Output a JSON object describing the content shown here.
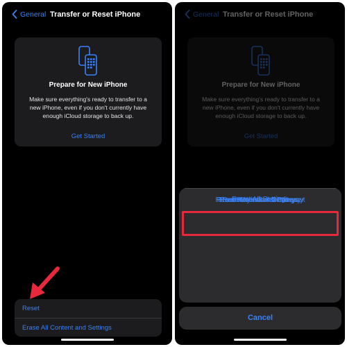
{
  "colors": {
    "accent": "#3a82f6",
    "highlight": "#e8283b",
    "arrow": "#e8283b"
  },
  "left": {
    "nav": {
      "back_label": "General",
      "title": "Transfer or Reset iPhone"
    },
    "card": {
      "icon": "transfer-phones-icon",
      "title": "Prepare for New iPhone",
      "description": "Make sure everything's ready to transfer to a new iPhone, even if you don't currently have enough iCloud storage to back up.",
      "link": "Get Started"
    },
    "list": {
      "items": [
        "Reset",
        "Erase All Content and Settings"
      ]
    }
  },
  "right": {
    "nav": {
      "back_label": "General",
      "title": "Transfer or Reset iPhone"
    },
    "card": {
      "icon": "transfer-phones-icon",
      "title": "Prepare for New iPhone",
      "description": "Make sure everything's ready to transfer to a new iPhone, even if you don't currently have enough iCloud storage to back up.",
      "link": "Get Started"
    },
    "action_sheet": {
      "options": [
        "Reset All Settings",
        "Reset Network Settings",
        "Reset Keyboard Dictionary",
        "Reset Home Screen Layout",
        "Reset Location & Privacy"
      ],
      "highlighted": "Reset Network Settings",
      "cancel": "Cancel"
    }
  }
}
